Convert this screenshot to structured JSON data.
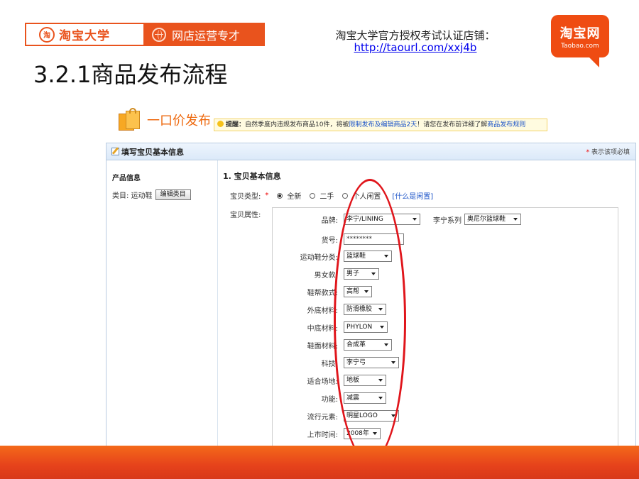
{
  "header": {
    "brand_left": "淘宝大学",
    "brand_right": "网店运营专才",
    "auth_text": "淘宝大学官方授权考试认证店铺：",
    "auth_link": "http://taourl.com/xxj4b",
    "logo_cn": "淘宝网",
    "logo_en": "Taobao.com",
    "slide_title": "3.2.1商品发布流程"
  },
  "publish": {
    "title": "一口价发布",
    "notice_bold": "提醒：",
    "notice_text1": "自然季度内违规发布商品10件，将被",
    "notice_link1": "限制发布及编辑商品2天",
    "notice_text2": "！请您在发布前详细了解",
    "notice_link2": "商品发布规则"
  },
  "panel": {
    "title": "填写宝贝基本信息",
    "required_star": "*",
    "required_note": "表示该项必填"
  },
  "sidebar": {
    "title": "产品信息",
    "category_label": "类目: 运动鞋",
    "edit_button": "编辑类目"
  },
  "form": {
    "section_title": "1. 宝贝基本信息",
    "type_label": "宝贝类型:",
    "required_star": "*",
    "type_options": [
      "全新",
      "二手",
      "个人闲置"
    ],
    "type_selected": "全新",
    "what_is_idle": "[什么是闲置]",
    "attr_label": "宝贝属性:",
    "attributes": [
      {
        "label": "品牌:",
        "value": "李宁/LINING",
        "series_label": "李宁系列",
        "series_value": "奥尼尔篮球鞋"
      },
      {
        "label": "货号:",
        "value": "********"
      },
      {
        "label": "运动鞋分类:",
        "value": "篮球鞋"
      },
      {
        "label": "男女款:",
        "value": "男子"
      },
      {
        "label": "鞋帮款式:",
        "value": "高帮"
      },
      {
        "label": "外底材料:",
        "value": "防滑橡胶"
      },
      {
        "label": "中底材料:",
        "value": "PHYLON"
      },
      {
        "label": "鞋面材料:",
        "value": "合成革"
      },
      {
        "label": "科技:",
        "value": "李宁弓"
      },
      {
        "label": "适合场地:",
        "value": "地板"
      },
      {
        "label": "功能:",
        "value": "减震"
      },
      {
        "label": "流行元素:",
        "value": "明星LOGO"
      },
      {
        "label": "上市时间:",
        "value": "2008年"
      }
    ]
  },
  "colors": {
    "brand_orange": "#e9531d",
    "annotation_red": "#e0151b",
    "link_blue": "#1b53c8"
  }
}
